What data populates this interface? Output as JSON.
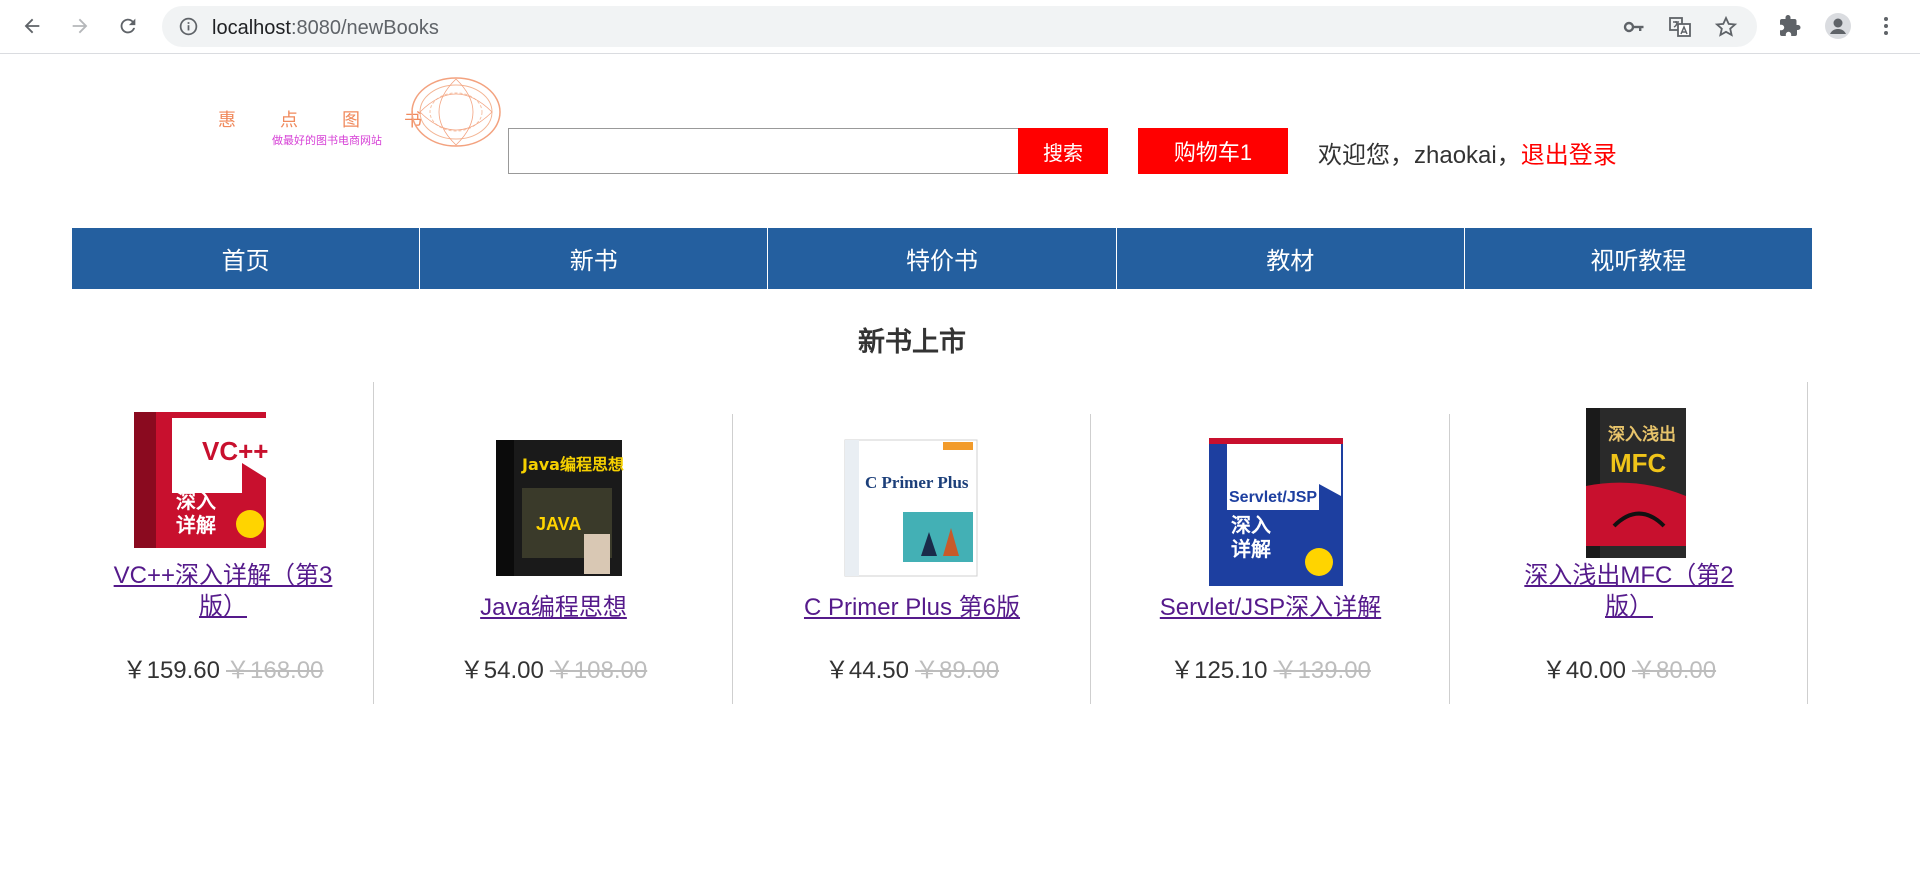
{
  "browser": {
    "url_host": "localhost",
    "url_rest": ":8080/newBooks"
  },
  "header": {
    "logo_chars": "惠点图书",
    "logo_slogan": "做最好的图书电商网站",
    "search_placeholder": "",
    "search_button": "搜索",
    "cart_label": "购物车1",
    "welcome_text": "欢迎您，zhaokai，",
    "logout_label": "退出登录"
  },
  "nav": {
    "items": [
      "首页",
      "新书",
      "特价书",
      "教材",
      "视听教程"
    ]
  },
  "section_title": "新书上市",
  "books": [
    {
      "title_line1": "VC++深入详解（第3",
      "title_line2": "版）",
      "price": "￥159.60",
      "old_price": "￥168.00",
      "cover_color": "#c8102e",
      "cover_text": "VC++"
    },
    {
      "title_line1": "Java编程思想",
      "title_line2": "",
      "price": "￥54.00",
      "old_price": "￥108.00",
      "cover_color": "#1a1a1a",
      "cover_text": "Java编程思想"
    },
    {
      "title_line1": "C Primer Plus 第6版",
      "title_line2": "",
      "price": "￥44.50",
      "old_price": "￥89.00",
      "cover_color": "#ffffff",
      "cover_text": "C Primer Plus"
    },
    {
      "title_line1": "Servlet/JSP深入详解",
      "title_line2": "",
      "price": "￥125.10",
      "old_price": "￥139.00",
      "cover_color": "#1d3fa0",
      "cover_text": "Servlet/JSP"
    },
    {
      "title_line1": "深入浅出MFC（第2",
      "title_line2": "版）",
      "price": "￥40.00",
      "old_price": "￥80.00",
      "cover_color": "#2a2a2a",
      "cover_text": "深入浅出 MFC"
    }
  ],
  "colors": {
    "nav_bg": "#245f9f",
    "accent_red": "#ff0000",
    "link_visited": "#551a8b"
  }
}
